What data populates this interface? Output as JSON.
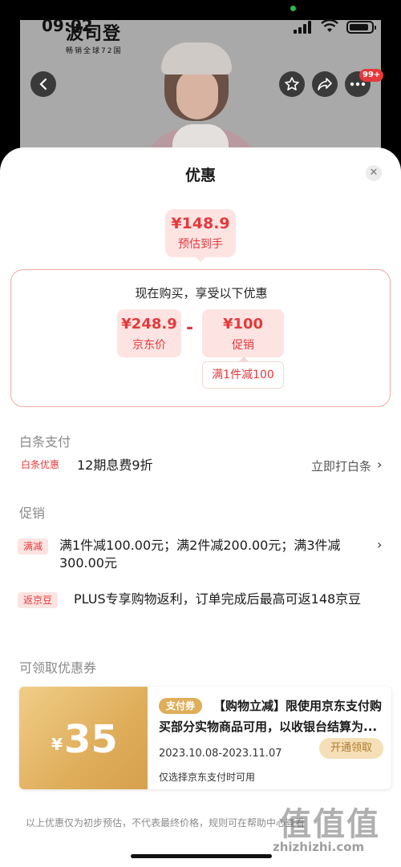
{
  "status_bar": {
    "time": "09:02"
  },
  "product_header": {
    "brand_name": "波司登",
    "brand_tagline": "畅销全球72国",
    "cart_badge": "99+"
  },
  "sheet": {
    "title": "优惠",
    "estimate": {
      "amount": "¥148.9",
      "label": "预估到手"
    },
    "breakdown": {
      "title": "现在购买，享受以下优惠",
      "jd_price": {
        "amount": "¥248.9",
        "label": "京东价"
      },
      "minus": "-",
      "promo": {
        "amount": "¥100",
        "label": "促销"
      },
      "promo_rule": "满1件减100"
    },
    "baitiao": {
      "section_title": "白条支付",
      "tag": "白条优惠",
      "text": "12期息费9折",
      "action": "立即打白条"
    },
    "promotion": {
      "section_title": "促销",
      "items": [
        {
          "tag": "满减",
          "text": "满1件减100.00元；满2件减200.00元；满3件减300.00元"
        },
        {
          "tag": "返京豆",
          "text": "PLUS专享购物返利，订单完成后最高可返148京豆"
        }
      ]
    },
    "coupons": {
      "section_title": "可领取优惠券",
      "coupon": {
        "currency": "¥",
        "value": "35",
        "tag": "支付券",
        "title": "【购物立减】限使用京东支付购买部分实物商品可用，以收银台结算为...",
        "date_range": "2023.10.08-2023.11.07",
        "note": "仅选择京东支付时可用",
        "button": "开通领取"
      }
    },
    "disclaimer": "以上优惠仅为初步预估，不代表最终价格，规则可在帮助中心查看",
    "watermark": {
      "text": "值值值",
      "url": "zhizhizhi.com"
    }
  },
  "colors": {
    "accent": "#e4393c",
    "accent_bg": "#fde4e2",
    "coupon_gold": "#dfae5b"
  }
}
